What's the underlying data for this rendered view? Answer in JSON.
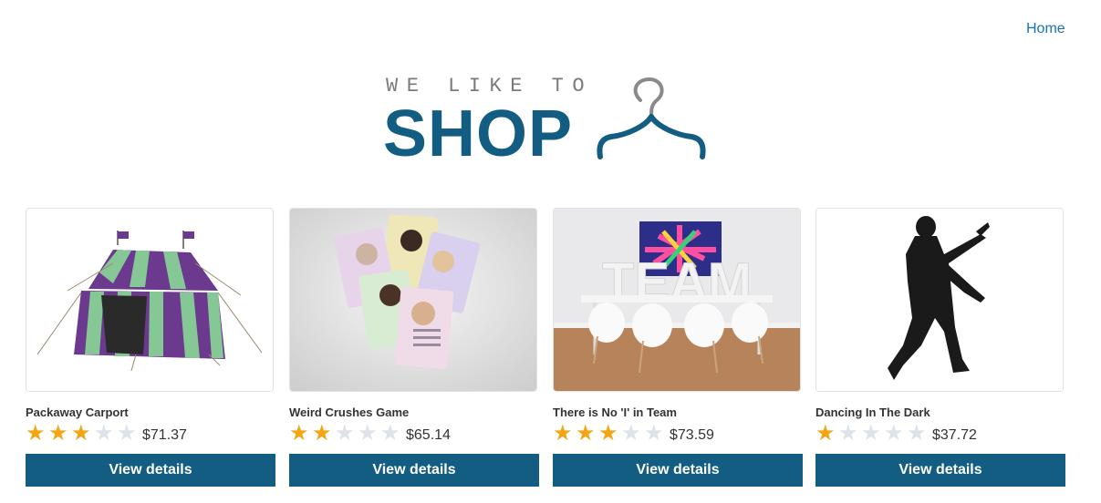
{
  "nav": {
    "home_label": "Home"
  },
  "logo": {
    "tagline": "WE LIKE TO",
    "wordmark": "SHOP"
  },
  "products": [
    {
      "name": "Packaway Carport",
      "rating": 3,
      "price": "$71.37",
      "button_label": "View details",
      "image": "striped-tent"
    },
    {
      "name": "Weird Crushes Game",
      "rating": 2,
      "price": "$65.14",
      "button_label": "View details",
      "image": "crush-cards"
    },
    {
      "name": "There is No 'I' in Team",
      "rating": 3,
      "price": "$73.59",
      "button_label": "View details",
      "image": "team-boardroom"
    },
    {
      "name": "Dancing In The Dark",
      "rating": 1,
      "price": "$37.72",
      "button_label": "View details",
      "image": "dancer-silhouette"
    }
  ],
  "max_rating": 5,
  "colors": {
    "brand": "#135d82",
    "star_on": "#f2a613",
    "star_off": "#dde3e8",
    "link": "#1a70b8"
  }
}
